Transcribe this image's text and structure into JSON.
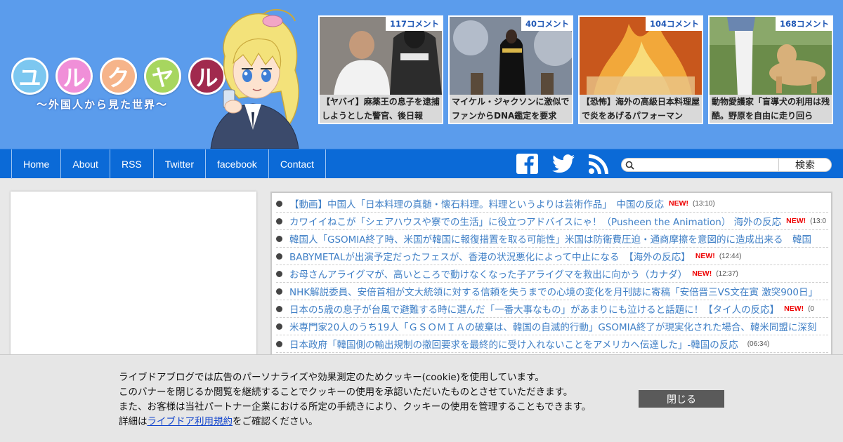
{
  "logo": {
    "chars": [
      "ユ",
      "ル",
      "ク",
      "ヤ",
      "ル"
    ],
    "colors": [
      "#7cc7f0",
      "#f08fd8",
      "#f6b48a",
      "#a7d65f",
      "#a12a4e"
    ],
    "subtitle": "～外国人から見た世界～"
  },
  "featured": [
    {
      "count": "117コメント",
      "title": "【ヤバイ】麻薬王の息子を逮捕しようとした警官、後日報"
    },
    {
      "count": "40コメント",
      "title": "マイケル・ジャクソンに激似でファンからDNA鑑定を要求"
    },
    {
      "count": "104コメント",
      "title": "【恐怖】海外の高級日本料理屋で炎をあげるパフォーマン"
    },
    {
      "count": "168コメント",
      "title": "動物愛護家「盲導犬の利用は残酷。野原を自由に走り回ら"
    }
  ],
  "nav": {
    "items": [
      "Home",
      "About",
      "RSS",
      "Twitter",
      "facebook",
      "Contact"
    ],
    "search_button": "検索",
    "search_placeholder": ""
  },
  "news": [
    {
      "title": "【動画】中国人「日本料理の真髄・懐石料理。料理というよりは芸術作品」　中国の反応",
      "new": "NEW!",
      "time": "(13:10)"
    },
    {
      "title": "カワイイねこが「シェアハウスや寮での生活」に役立つアドバイスにゃ！（Pusheen the Animation）  海外の反応",
      "new": "NEW!",
      "time": "(13:0"
    },
    {
      "title": "韓国人「GSOMIA終了時、米国が韓国に報復措置を取る可能性」米国は防衛費圧迫・通商摩擦を意図的に造成出来る　韓国",
      "new": "",
      "time": ""
    },
    {
      "title": "BABYMETALが出演予定だったフェスが、香港の状況悪化によって中止になる　【海外の反応】",
      "new": "NEW!",
      "time": "(12:44)"
    },
    {
      "title": "お母さんアライグマが、高いところで動けなくなった子アライグマを救出に向かう（カナダ）",
      "new": "NEW!",
      "time": "(12:37)"
    },
    {
      "title": "NHK解説委員、安倍首相が文大統領に対する信頼を失うまでの心境の変化を月刊誌に寄稿「安倍晋三VS文在寅 激突900日」",
      "new": "",
      "time": ""
    },
    {
      "title": "日本の5歳の息子が台風で避難する時に選んだ「一番大事なもの」があまりにも泣けると話題に！【タイ人の反応】",
      "new": "NEW!",
      "time": "(0"
    },
    {
      "title": "米専門家20人のうち19人「ＧＳＯＭＩＡの破棄は、韓国の自滅的行動」GSOMIA終了が現実化された場合、韓米同盟に深刻",
      "new": "",
      "time": ""
    },
    {
      "title": "日本政府「韓国側の輸出規制の撤回要求を最終的に受け入れないことをアメリカへ伝達した」-韓国の反応",
      "new": "",
      "time": "(06:34)"
    }
  ],
  "cookie": {
    "line1": "ライブドアブログでは広告のパーソナライズや効果測定のためクッキー(cookie)を使用しています。",
    "line2": "このバナーを閉じるか閲覧を継続することでクッキーの使用を承認いただいたものとさせていただきます。",
    "line3": "また、お客様は当社パートナー企業における所定の手続きにより、クッキーの使用を管理することもできます。",
    "line4_prefix": "詳細は",
    "line4_link": "ライブドア利用規約",
    "line4_suffix": "をご確認ください。",
    "close_button": "閉じる"
  }
}
